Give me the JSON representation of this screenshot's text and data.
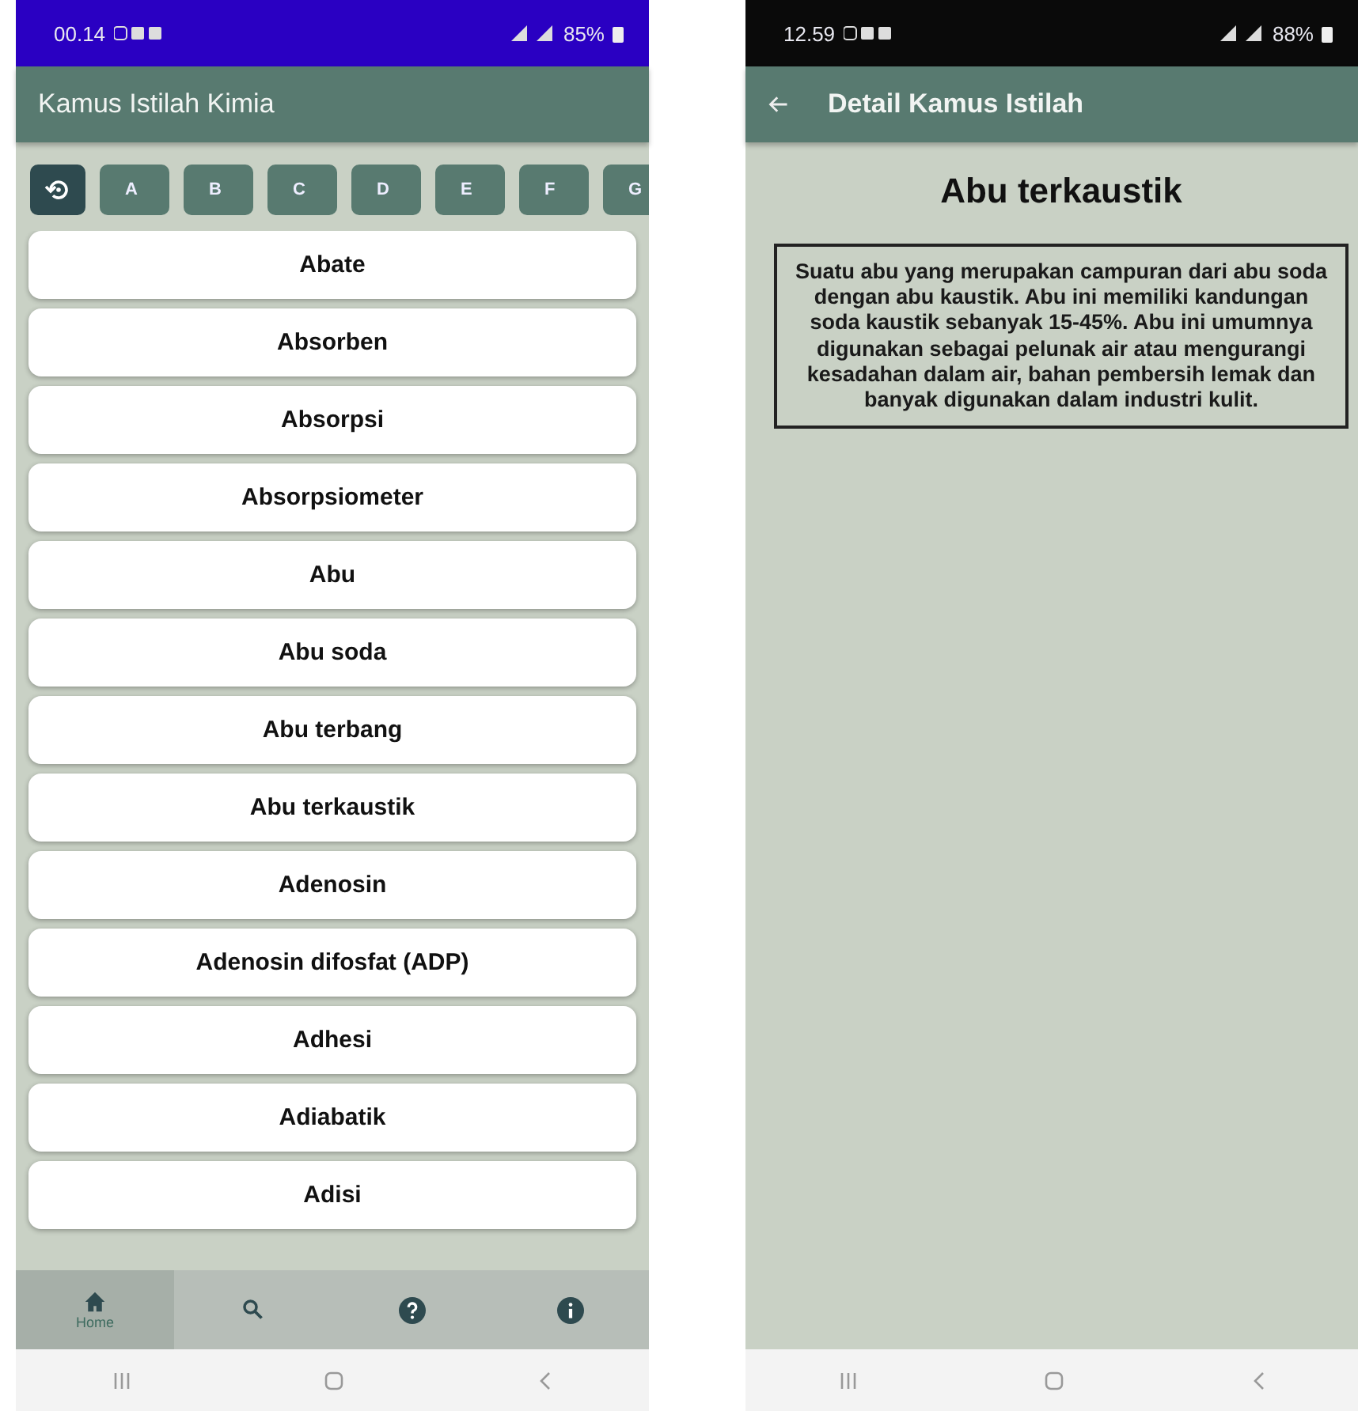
{
  "list_screen": {
    "status_bar": {
      "time": "00.14",
      "battery": "85%"
    },
    "app_bar": {
      "title": "Kamus Istilah Kimia"
    },
    "letter_filter": [
      {
        "kind": "reset"
      },
      {
        "kind": "letter",
        "label": "A"
      },
      {
        "kind": "letter",
        "label": "B"
      },
      {
        "kind": "letter",
        "label": "C"
      },
      {
        "kind": "letter",
        "label": "D"
      },
      {
        "kind": "letter",
        "label": "E"
      },
      {
        "kind": "letter",
        "label": "F"
      },
      {
        "kind": "letter",
        "label": "G"
      }
    ],
    "terms": [
      "Abate",
      "Absorben",
      "Absorpsi",
      "Absorpsiometer",
      "Abu",
      "Abu soda",
      "Abu terbang",
      "Abu terkaustik",
      "Adenosin",
      "Adenosin difosfat (ADP)",
      "Adhesi",
      "Adiabatik",
      "Adisi"
    ],
    "bottom_nav": [
      {
        "kind": "home",
        "label": "Home",
        "selected": true
      },
      {
        "kind": "search",
        "selected": false
      },
      {
        "kind": "help",
        "selected": false
      },
      {
        "kind": "info",
        "selected": false
      }
    ]
  },
  "detail_screen": {
    "status_bar": {
      "time": "12.59",
      "battery": "88%"
    },
    "app_bar": {
      "title": "Detail Kamus Istilah"
    },
    "term": "Abu terkaustik",
    "definition": "Suatu abu yang merupakan campuran dari abu soda dengan abu kaustik. Abu ini memiliki kandungan soda kaustik sebanyak 15-45%. Abu ini umumnya digunakan sebagai pelunak air atau mengurangi kesadahan dalam air, bahan pembersih lemak dan banyak digunakan dalam industri kulit."
  }
}
